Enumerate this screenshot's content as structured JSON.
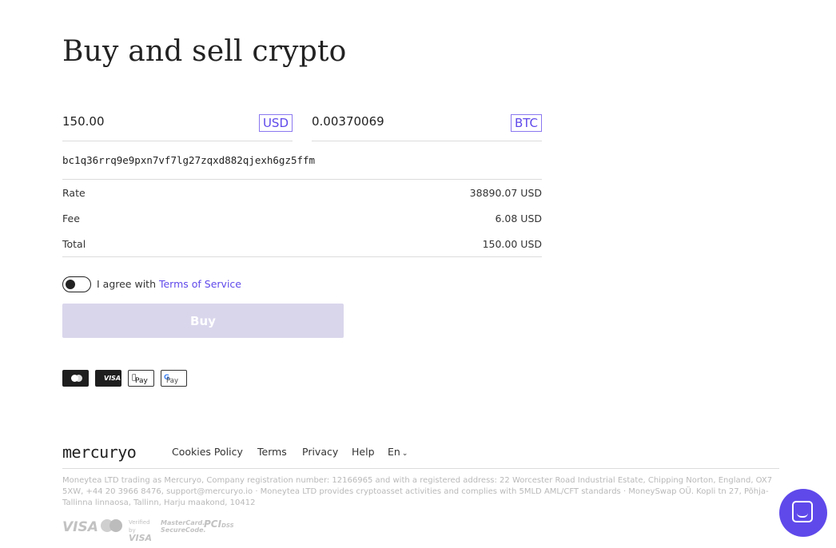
{
  "page": {
    "title": "Buy and sell crypto"
  },
  "form": {
    "pay_amount": "150.00",
    "pay_currency": "USD",
    "receive_amount": "0.00370069",
    "receive_currency": "BTC",
    "wallet_address": "bc1q36rrq9e9pxn7vf7lg27zqxd882qjexh6gz5ffm"
  },
  "summary": {
    "rate_label": "Rate",
    "rate_value": "38890.07 USD",
    "fee_label": "Fee",
    "fee_value": "6.08 USD",
    "total_label": "Total",
    "total_value": "150.00 USD"
  },
  "agreement": {
    "text": "I agree with",
    "link": "Terms of Service",
    "checked": false
  },
  "buy_button": "Buy",
  "payment_methods": {
    "visa": "VISA",
    "apple_pay": "Pay",
    "google_pay_g": "G",
    "google_pay": "Pay"
  },
  "footer": {
    "logo": "mercuryo",
    "links": [
      "Cookies Policy",
      "Terms",
      "Privacy",
      "Help"
    ],
    "language": "En",
    "legal": "Moneytea LTD trading as Mercuryo, Company registration number: 12166965 and with a registered address: 22 Worcester Road Industrial Estate, Chipping Norton, England, OX7 5XW, +44 20 3966 8476, support@mercuryo.io · Moneytea LTD provides cryptoasset activities and complies with 5MLD AML/CFT standards · MoneySwap OÜ. Kopli tn 27, Põhja-Tallinna linnaosa, Tallinn, Harju maakond, 10412",
    "cert_visa": "VISA",
    "cert_verified_line1": "Verified by",
    "cert_verified_line2": "VISA",
    "cert_mastercard_line1": "MasterCard.",
    "cert_mastercard_line2": "SecureCode.",
    "cert_pci": "PCI",
    "cert_dss": "DSS"
  },
  "colors": {
    "accent": "#5f49ea",
    "button_disabled": "#d9d6ec",
    "divider": "#dcdcdc",
    "legal_text": "#b9b9b9"
  },
  "icons": {
    "chat": "chat-bubble-icon",
    "language_chevron": "chevron-down-icon"
  }
}
